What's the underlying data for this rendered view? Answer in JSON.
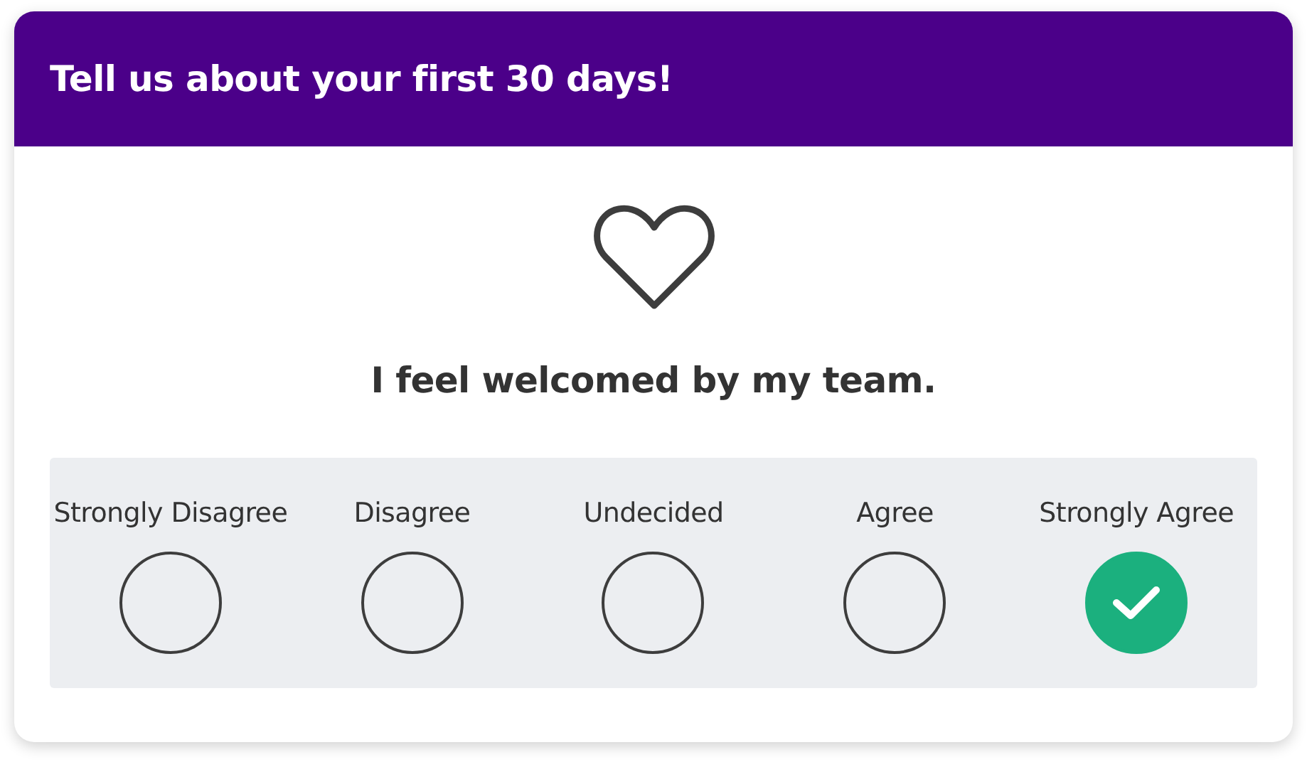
{
  "header": {
    "title": "Tell us about your first 30 days!"
  },
  "question": "I feel welcomed by my team.",
  "options": [
    {
      "label": "Strongly Disagree",
      "selected": false
    },
    {
      "label": "Disagree",
      "selected": false
    },
    {
      "label": "Undecided",
      "selected": false
    },
    {
      "label": "Agree",
      "selected": false
    },
    {
      "label": "Strongly Agree",
      "selected": true
    }
  ]
}
